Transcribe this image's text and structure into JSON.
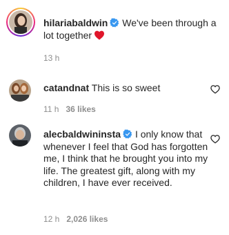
{
  "comments": [
    {
      "username": "hilariabaldwin",
      "verified": true,
      "text": "We've been through a lot together",
      "emoji": "red-heart",
      "time": "13 h",
      "likes": ""
    },
    {
      "username": "catandnat",
      "verified": false,
      "text": "This is so sweet",
      "time": "11 h",
      "likes": "36 likes"
    },
    {
      "username": "alecbaldwininsta",
      "verified": true,
      "text": "I only know that whenever I feel that God has forgotten me, I think that he brought you into my life. The greatest gift, along with my children, I have ever received.",
      "time": "12 h",
      "likes": "2,026 likes"
    }
  ],
  "colors": {
    "verified_blue": "#3897f0",
    "heart_red": "#ed4956",
    "meta_gray": "#8e8e8e"
  }
}
